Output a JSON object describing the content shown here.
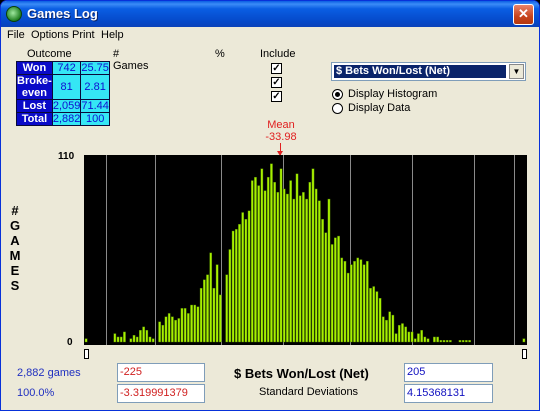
{
  "window": {
    "title": "Games Log",
    "close_glyph": "✕",
    "icon": "dice-icon"
  },
  "menu": [
    "File",
    "Options",
    "Print",
    "Help"
  ],
  "stats": {
    "headers": {
      "outcome": "Outcome",
      "games": "# Games",
      "pct": "%",
      "include": "Include"
    },
    "rows": [
      {
        "label": "Won",
        "games": "742",
        "pct": "25.75",
        "include": true
      },
      {
        "label": "Broke-even",
        "games": "81",
        "pct": "2.81",
        "include": true
      },
      {
        "label": "Lost",
        "games": "2,059",
        "pct": "71.44",
        "include": true
      },
      {
        "label": "Total",
        "games": "2,882",
        "pct": "100"
      }
    ]
  },
  "dropdown": {
    "selected": "$ Bets Won/Lost (Net)"
  },
  "display_options": [
    {
      "label": "Display Histogram",
      "selected": true
    },
    {
      "label": "Display Data",
      "selected": false
    }
  ],
  "mean": {
    "label": "Mean",
    "value": "-33.98"
  },
  "chart_data": {
    "type": "bar",
    "ylabel": "# GAMES",
    "xlabel": "$ Bets Won/Lost (Net)",
    "ylim": [
      0,
      110
    ],
    "yticks": [
      "110",
      "0"
    ],
    "values": [
      2,
      0,
      0,
      0,
      0,
      0,
      0,
      0,
      0,
      5,
      3,
      3,
      6,
      0,
      2,
      4,
      3,
      7,
      9,
      7,
      3,
      2,
      0,
      12,
      10,
      15,
      17,
      15,
      13,
      14,
      20,
      20,
      17,
      22,
      22,
      21,
      32,
      37,
      40,
      53,
      32,
      46,
      28,
      0,
      40,
      55,
      66,
      67,
      70,
      77,
      73,
      78,
      96,
      98,
      93,
      103,
      90,
      98,
      106,
      95,
      89,
      103,
      91,
      88,
      96,
      85,
      100,
      87,
      89,
      85,
      95,
      103,
      91,
      84,
      73,
      65,
      85,
      58,
      62,
      63,
      50,
      48,
      41,
      46,
      48,
      50,
      49,
      46,
      48,
      32,
      33,
      30,
      26,
      15,
      13,
      18,
      16,
      5,
      10,
      11,
      9,
      6,
      6,
      2,
      5,
      7,
      3,
      2,
      0,
      3,
      3,
      1,
      1,
      1,
      1,
      0,
      0,
      1,
      1,
      1,
      1,
      0,
      0,
      0,
      0,
      0,
      0,
      0,
      0,
      0,
      0,
      0,
      0,
      0,
      0,
      0,
      0,
      2
    ],
    "colors": {
      "bar": "#a8f000",
      "bar_edge": "#4a7a00",
      "background": "#000000",
      "grid": "#8a8a8a"
    }
  },
  "bottom": {
    "games": "2,882 games",
    "percent": "100.0%",
    "min_value": "-225",
    "min_sd": "-3.319991379",
    "max_value": "205",
    "max_sd": "4.15368131",
    "sd_label": "Standard Deviations"
  }
}
